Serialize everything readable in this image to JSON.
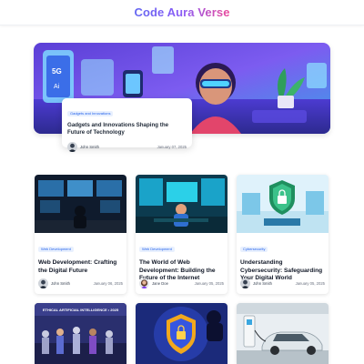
{
  "header": {
    "brand": "Code Aura Verse"
  },
  "featured": {
    "category": "Gadgets and Innovations",
    "title": "Gadgets and Innovations Shaping the Future of Technology",
    "author": "John Smith",
    "date": "January 07, 2025",
    "image_icon": "vr-headset-technology-illustration"
  },
  "posts": [
    {
      "category": "Web Development",
      "title": "Web Development: Crafting the Digital Future",
      "author": "John Smith",
      "date": "January 06, 2025",
      "image_icon": "developers-control-room-illustration"
    },
    {
      "category": "Web Development",
      "title": "The World of Web Development: Building the Future of the Internet",
      "author": "Jane Doe",
      "date": "January 05, 2025",
      "image_icon": "developer-workstation-illustration"
    },
    {
      "category": "Cybersecurity",
      "title": "Understanding Cybersecurity: Safeguarding Your Digital World",
      "author": "John Smith",
      "date": "January 05, 2025",
      "image_icon": "security-shield-illustration"
    }
  ],
  "more_posts": [
    {
      "image_icon": "ai-ethics-crowd-illustration",
      "image_text": "ETHICAL ARTIFICIAL INTELLIGENCE • 2025"
    },
    {
      "image_icon": "hacker-shield-illustration"
    },
    {
      "image_icon": "electric-car-charging-illustration"
    }
  ],
  "colors": {
    "accent": "#2563eb",
    "badge_bg": "#e8f0fe",
    "brand_start": "#6366f1",
    "brand_end": "#ec4899"
  }
}
